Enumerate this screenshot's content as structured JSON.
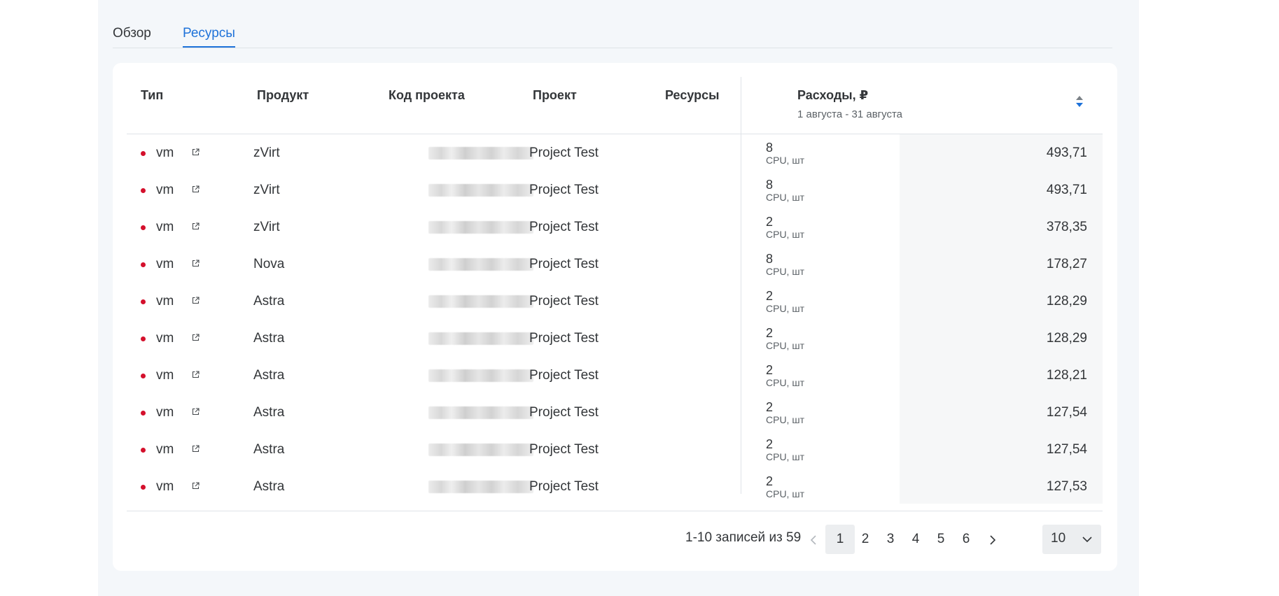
{
  "tabs": [
    {
      "label": "Обзор",
      "active": false
    },
    {
      "label": "Ресурсы",
      "active": true
    }
  ],
  "table": {
    "columns": {
      "type": "Тип",
      "product": "Продукт",
      "code": "Код проекта",
      "project": "Проект",
      "resources": "Ресурсы",
      "spend": "Расходы, ₽",
      "spend_period": "1 августа - 31 августа"
    },
    "rows": [
      {
        "type": "vm",
        "product": "zVirt",
        "project": "Project Test",
        "resource_value": "8",
        "resource_unit": "CPU, шт",
        "spend": "493,71"
      },
      {
        "type": "vm",
        "product": "zVirt",
        "project": "Project Test",
        "resource_value": "8",
        "resource_unit": "CPU, шт",
        "spend": "493,71"
      },
      {
        "type": "vm",
        "product": "zVirt",
        "project": "Project Test",
        "resource_value": "2",
        "resource_unit": "CPU, шт",
        "spend": "378,35"
      },
      {
        "type": "vm",
        "product": "Nova",
        "project": "Project Test",
        "resource_value": "8",
        "resource_unit": "CPU, шт",
        "spend": "178,27"
      },
      {
        "type": "vm",
        "product": "Astra",
        "project": "Project Test",
        "resource_value": "2",
        "resource_unit": "CPU, шт",
        "spend": "128,29"
      },
      {
        "type": "vm",
        "product": "Astra",
        "project": "Project Test",
        "resource_value": "2",
        "resource_unit": "CPU, шт",
        "spend": "128,29"
      },
      {
        "type": "vm",
        "product": "Astra",
        "project": "Project Test",
        "resource_value": "2",
        "resource_unit": "CPU, шт",
        "spend": "128,21"
      },
      {
        "type": "vm",
        "product": "Astra",
        "project": "Project Test",
        "resource_value": "2",
        "resource_unit": "CPU, шт",
        "spend": "127,54"
      },
      {
        "type": "vm",
        "product": "Astra",
        "project": "Project Test",
        "resource_value": "2",
        "resource_unit": "CPU, шт",
        "spend": "127,54"
      },
      {
        "type": "vm",
        "product": "Astra",
        "project": "Project Test",
        "resource_value": "2",
        "resource_unit": "CPU, шт",
        "spend": "127,53"
      }
    ]
  },
  "pagination": {
    "summary": "1-10 записей из 59",
    "pages": [
      "1",
      "2",
      "3",
      "4",
      "5",
      "6"
    ],
    "current_page": "1",
    "page_size": "10"
  },
  "icons": {
    "status_dot": "status-dot-icon",
    "external_link": "external-link-icon",
    "sort": "sort-icon",
    "prev": "chevron-left-icon",
    "next": "chevron-right-icon",
    "dropdown": "chevron-down-icon"
  },
  "colors": {
    "accent": "#1e72d9",
    "status_red": "#d4102c",
    "panel_bg": "#f4f7fa"
  }
}
